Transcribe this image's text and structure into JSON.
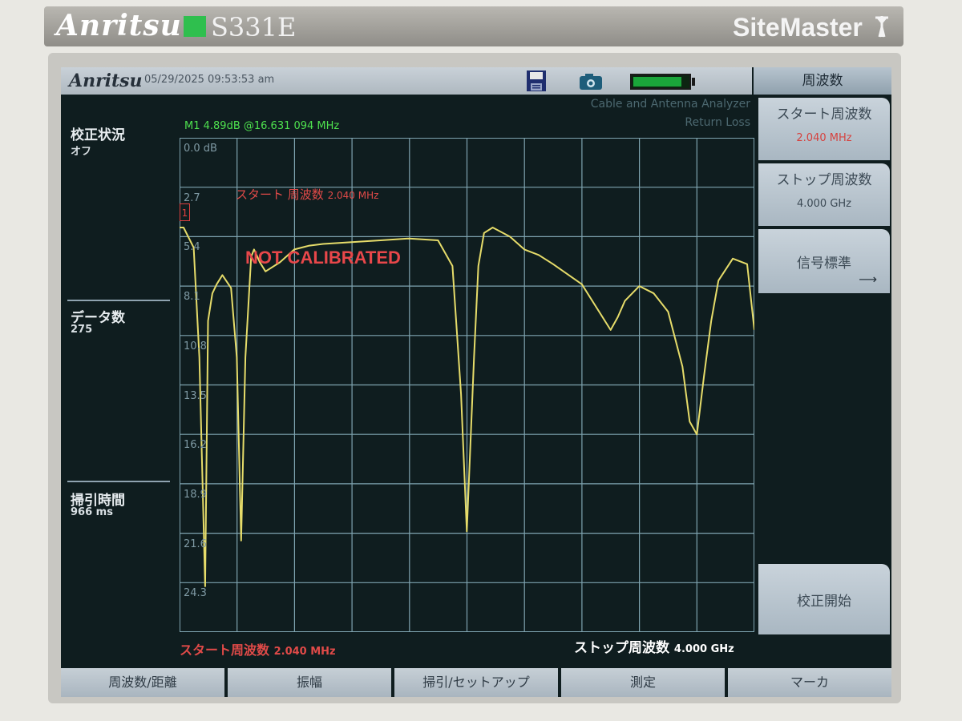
{
  "device": {
    "brand": "Anritsu",
    "model": "S331E",
    "product_name": "SiteMaster",
    "brand_color": "#2fbf4e"
  },
  "status_bar": {
    "logo": "Anritsu",
    "datetime": "05/29/2025 09:53:53 am",
    "icons": [
      "save-disk-icon",
      "camera-icon",
      "battery-icon"
    ],
    "battery_level": 0.88
  },
  "mode": {
    "line1": "Cable and Antenna Analyzer",
    "line2": "Return Loss"
  },
  "left_panel": {
    "cal_status_label": "校正状況",
    "cal_status_value": "オフ",
    "data_points_label": "データ数",
    "data_points_value": "275",
    "sweep_time_label": "掃引時間",
    "sweep_time_value": "966 ms"
  },
  "marker": {
    "readout": "M1 4.89dB @16.631 094 MHz",
    "id": "1"
  },
  "plot": {
    "warning": "NOT CALIBRATED",
    "start_note_label": "スタート 周波数",
    "start_note_value": "2.040 MHz",
    "trace_color": "#e6dc6a",
    "grid_color": "#7fa4b0"
  },
  "axis": {
    "start_label": "スタート周波数",
    "start_value": "2.040 MHz",
    "stop_label": "ストップ周波数",
    "stop_value": "4.000 GHz"
  },
  "softkeys": {
    "header": "周波数",
    "start_freq_label": "スタート周波数",
    "start_freq_value": "2.040 MHz",
    "stop_freq_label": "ストップ周波数",
    "stop_freq_value": "4.000 GHz",
    "signal_standard_label": "信号標準",
    "signal_standard_arrow": "⟶",
    "cal_start_label": "校正開始"
  },
  "bottom_menu": [
    "周波数/距離",
    "振幅",
    "掃引/セットアップ",
    "測定",
    "マーカ"
  ],
  "chart_data": {
    "type": "line",
    "xlim": [
      2.04,
      4000
    ],
    "ylim": [
      0,
      27
    ],
    "yticks": [
      "0.0 dB",
      "2.7",
      "5.4",
      "8.1",
      "10.8",
      "13.5",
      "16.2",
      "18.9",
      "21.6",
      "24.3"
    ],
    "series": [
      {
        "x": [
          2.04,
          30,
          100,
          140,
          180,
          200,
          230,
          260,
          300,
          360,
          400,
          430,
          460,
          500,
          520,
          560,
          600,
          700,
          800,
          900,
          1000,
          1200,
          1400,
          1600,
          1800,
          1900,
          1960,
          2000,
          2050,
          2080,
          2120,
          2180,
          2300,
          2400,
          2500,
          2600,
          2800,
          3000,
          3050,
          3100,
          3200,
          3300,
          3400,
          3500,
          3550,
          3600,
          3650,
          3700,
          3750,
          3850,
          3950,
          4000
        ],
        "y": [
          4.9,
          4.9,
          6.0,
          12.0,
          24.5,
          10.0,
          8.5,
          8.0,
          7.5,
          8.2,
          12.0,
          22.0,
          12.0,
          6.5,
          6.1,
          6.8,
          7.3,
          6.8,
          6.1,
          5.9,
          5.8,
          5.7,
          5.6,
          5.5,
          5.6,
          7.0,
          14.0,
          21.5,
          12.0,
          7.0,
          5.2,
          4.9,
          5.4,
          6.1,
          6.4,
          6.9,
          8.0,
          10.5,
          9.8,
          8.9,
          8.1,
          8.5,
          9.5,
          12.5,
          15.5,
          16.2,
          13.0,
          10.0,
          7.8,
          6.6,
          6.9,
          10.5
        ]
      }
    ],
    "grid": true
  }
}
